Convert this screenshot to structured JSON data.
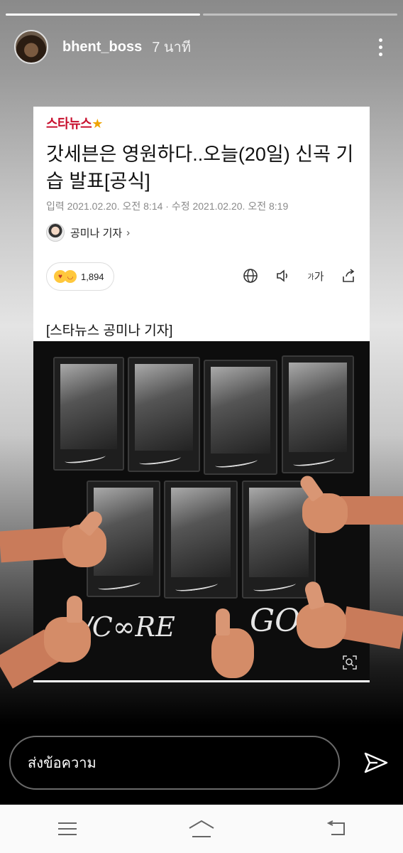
{
  "story": {
    "username": "bhent_boss",
    "time_ago": "7 นาที",
    "progress": {
      "total": 2,
      "current": 1
    }
  },
  "article": {
    "source_logo": "스타뉴스",
    "title": "갓세븐은 영원하다..오늘(20일) 신곡 기습 발표[공식]",
    "meta": "입력 2021.02.20. 오전 8:14 · 수정 2021.02.20. 오전 8:19",
    "reporter": "공미나 기자",
    "reaction_count": "1,894",
    "font_tool_label": "가",
    "caption": "[스타뉴스 공미나 기자]",
    "photo_text_left": "/C∞RE",
    "photo_text_right": "GOT7"
  },
  "message_bar": {
    "placeholder": "ส่งข้อความ"
  },
  "icons": {
    "more": "more-vertical-icon",
    "send": "send-icon",
    "globe": "globe-icon",
    "speaker": "speaker-icon",
    "share": "share-icon",
    "zoom": "zoom-icon",
    "nav_recents": "recents-icon",
    "nav_home": "home-icon",
    "nav_back": "back-icon"
  },
  "colors": {
    "logo_red": "#c8102e",
    "logo_star": "#f0a400"
  }
}
